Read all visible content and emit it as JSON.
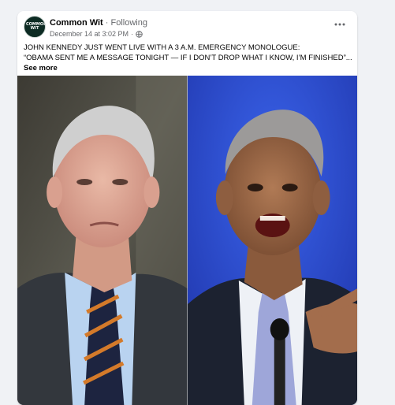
{
  "post": {
    "page_name": "Common Wit",
    "separator": " · ",
    "follow_status": "Following",
    "timestamp": "December 14 at 3:02 PM",
    "meta_separator": " · ",
    "avatar_text": "COMMON WIT",
    "text_line1": "JOHN KENNEDY JUST WENT LIVE WITH A 3 A.M. EMERGENCY MONOLOGUE:",
    "text_line2": "“OBAMA SENT ME A MESSAGE TONIGHT — IF I DON’T DROP WHAT I KNOW, I’M FINISHED”...",
    "see_more": "See more",
    "icons": {
      "audience": "globe-icon",
      "options": "more-options-icon"
    }
  },
  "colors": {
    "page_background": "#f0f2f5",
    "card_background": "#ffffff",
    "secondary_text": "#65676b",
    "right_backdrop": "#2447c9"
  }
}
